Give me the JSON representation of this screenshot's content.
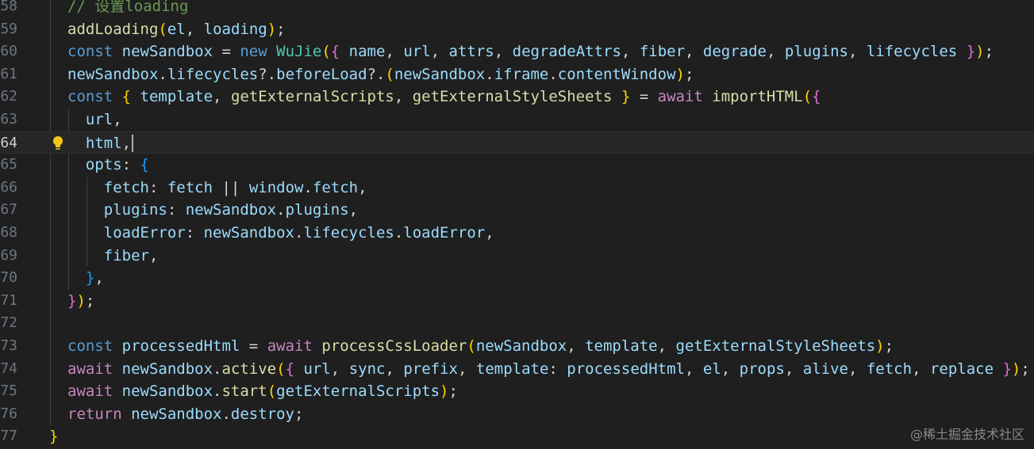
{
  "editor": {
    "active_line": "64",
    "lines": [
      {
        "num": "58",
        "tokens": [
          {
            "t": "// 设置loading",
            "c": "com"
          }
        ]
      },
      {
        "num": "59",
        "tokens": [
          {
            "t": "addLoading",
            "c": "fn"
          },
          {
            "t": "(",
            "c": "b1"
          },
          {
            "t": "el",
            "c": "var"
          },
          {
            "t": ", ",
            "c": "txt"
          },
          {
            "t": "loading",
            "c": "var"
          },
          {
            "t": ")",
            "c": "b1"
          },
          {
            "t": ";",
            "c": "txt"
          }
        ]
      },
      {
        "num": "60",
        "tokens": [
          {
            "t": "const ",
            "c": "kw"
          },
          {
            "t": "newSandbox",
            "c": "var"
          },
          {
            "t": " = ",
            "c": "txt"
          },
          {
            "t": "new ",
            "c": "kw"
          },
          {
            "t": "WuJie",
            "c": "cls"
          },
          {
            "t": "(",
            "c": "b1"
          },
          {
            "t": "{",
            "c": "b2"
          },
          {
            "t": " name",
            "c": "var"
          },
          {
            "t": ", ",
            "c": "txt"
          },
          {
            "t": "url",
            "c": "var"
          },
          {
            "t": ", ",
            "c": "txt"
          },
          {
            "t": "attrs",
            "c": "var"
          },
          {
            "t": ", ",
            "c": "txt"
          },
          {
            "t": "degradeAttrs",
            "c": "var"
          },
          {
            "t": ", ",
            "c": "txt"
          },
          {
            "t": "fiber",
            "c": "var"
          },
          {
            "t": ", ",
            "c": "txt"
          },
          {
            "t": "degrade",
            "c": "var"
          },
          {
            "t": ", ",
            "c": "txt"
          },
          {
            "t": "plugins",
            "c": "var"
          },
          {
            "t": ", ",
            "c": "txt"
          },
          {
            "t": "lifecycles ",
            "c": "var"
          },
          {
            "t": "}",
            "c": "b2"
          },
          {
            "t": ")",
            "c": "b1"
          },
          {
            "t": ";",
            "c": "txt"
          }
        ]
      },
      {
        "num": "61",
        "tokens": [
          {
            "t": "newSandbox",
            "c": "var"
          },
          {
            "t": ".",
            "c": "txt"
          },
          {
            "t": "lifecycles",
            "c": "var"
          },
          {
            "t": "?.",
            "c": "txt"
          },
          {
            "t": "beforeLoad",
            "c": "var"
          },
          {
            "t": "?.",
            "c": "txt"
          },
          {
            "t": "(",
            "c": "b1"
          },
          {
            "t": "newSandbox",
            "c": "var"
          },
          {
            "t": ".",
            "c": "txt"
          },
          {
            "t": "iframe",
            "c": "var"
          },
          {
            "t": ".",
            "c": "txt"
          },
          {
            "t": "contentWindow",
            "c": "var"
          },
          {
            "t": ")",
            "c": "b1"
          },
          {
            "t": ";",
            "c": "txt"
          }
        ]
      },
      {
        "num": "62",
        "tokens": [
          {
            "t": "const ",
            "c": "kw"
          },
          {
            "t": "{",
            "c": "b1"
          },
          {
            "t": " template",
            "c": "var"
          },
          {
            "t": ", ",
            "c": "txt"
          },
          {
            "t": "getExternalScripts",
            "c": "fn"
          },
          {
            "t": ", ",
            "c": "txt"
          },
          {
            "t": "getExternalStyleSheets ",
            "c": "fn"
          },
          {
            "t": "}",
            "c": "b1"
          },
          {
            "t": " = ",
            "c": "txt"
          },
          {
            "t": "await ",
            "c": "ctl"
          },
          {
            "t": "importHTML",
            "c": "fn"
          },
          {
            "t": "(",
            "c": "b1"
          },
          {
            "t": "{",
            "c": "b2"
          }
        ]
      },
      {
        "num": "63",
        "tokens": [
          {
            "t": "  url",
            "c": "var"
          },
          {
            "t": ",",
            "c": "txt"
          }
        ]
      },
      {
        "num": "64",
        "tokens": [
          {
            "t": "  html",
            "c": "var"
          },
          {
            "t": ",",
            "c": "txt"
          }
        ],
        "cursor": true,
        "bulb": true
      },
      {
        "num": "65",
        "tokens": [
          {
            "t": "  opts",
            "c": "var"
          },
          {
            "t": ": ",
            "c": "txt"
          },
          {
            "t": "{",
            "c": "b3"
          }
        ]
      },
      {
        "num": "66",
        "tokens": [
          {
            "t": "    fetch",
            "c": "var"
          },
          {
            "t": ": ",
            "c": "txt"
          },
          {
            "t": "fetch",
            "c": "var"
          },
          {
            "t": " || ",
            "c": "txt"
          },
          {
            "t": "window",
            "c": "var"
          },
          {
            "t": ".",
            "c": "txt"
          },
          {
            "t": "fetch",
            "c": "var"
          },
          {
            "t": ",",
            "c": "txt"
          }
        ]
      },
      {
        "num": "67",
        "tokens": [
          {
            "t": "    plugins",
            "c": "var"
          },
          {
            "t": ": ",
            "c": "txt"
          },
          {
            "t": "newSandbox",
            "c": "var"
          },
          {
            "t": ".",
            "c": "txt"
          },
          {
            "t": "plugins",
            "c": "var"
          },
          {
            "t": ",",
            "c": "txt"
          }
        ]
      },
      {
        "num": "68",
        "tokens": [
          {
            "t": "    loadError",
            "c": "var"
          },
          {
            "t": ": ",
            "c": "txt"
          },
          {
            "t": "newSandbox",
            "c": "var"
          },
          {
            "t": ".",
            "c": "txt"
          },
          {
            "t": "lifecycles",
            "c": "var"
          },
          {
            "t": ".",
            "c": "txt"
          },
          {
            "t": "loadError",
            "c": "var"
          },
          {
            "t": ",",
            "c": "txt"
          }
        ]
      },
      {
        "num": "69",
        "tokens": [
          {
            "t": "    fiber",
            "c": "var"
          },
          {
            "t": ",",
            "c": "txt"
          }
        ]
      },
      {
        "num": "70",
        "tokens": [
          {
            "t": "  }",
            "c": "b3"
          },
          {
            "t": ",",
            "c": "txt"
          }
        ]
      },
      {
        "num": "71",
        "tokens": [
          {
            "t": "}",
            "c": "b2"
          },
          {
            "t": ")",
            "c": "b1"
          },
          {
            "t": ";",
            "c": "txt"
          }
        ]
      },
      {
        "num": "72",
        "tokens": []
      },
      {
        "num": "73",
        "tokens": [
          {
            "t": "const ",
            "c": "kw"
          },
          {
            "t": "processedHtml",
            "c": "var"
          },
          {
            "t": " = ",
            "c": "txt"
          },
          {
            "t": "await ",
            "c": "ctl"
          },
          {
            "t": "processCssLoader",
            "c": "fn"
          },
          {
            "t": "(",
            "c": "b1"
          },
          {
            "t": "newSandbox",
            "c": "var"
          },
          {
            "t": ", ",
            "c": "txt"
          },
          {
            "t": "template",
            "c": "var"
          },
          {
            "t": ", ",
            "c": "txt"
          },
          {
            "t": "getExternalStyleSheets",
            "c": "var"
          },
          {
            "t": ")",
            "c": "b1"
          },
          {
            "t": ";",
            "c": "txt"
          }
        ]
      },
      {
        "num": "74",
        "tokens": [
          {
            "t": "await ",
            "c": "ctl"
          },
          {
            "t": "newSandbox",
            "c": "var"
          },
          {
            "t": ".",
            "c": "txt"
          },
          {
            "t": "active",
            "c": "fn"
          },
          {
            "t": "(",
            "c": "b1"
          },
          {
            "t": "{",
            "c": "b2"
          },
          {
            "t": " url",
            "c": "var"
          },
          {
            "t": ", ",
            "c": "txt"
          },
          {
            "t": "sync",
            "c": "var"
          },
          {
            "t": ", ",
            "c": "txt"
          },
          {
            "t": "prefix",
            "c": "var"
          },
          {
            "t": ", ",
            "c": "txt"
          },
          {
            "t": "template",
            "c": "var"
          },
          {
            "t": ": ",
            "c": "txt"
          },
          {
            "t": "processedHtml",
            "c": "var"
          },
          {
            "t": ", ",
            "c": "txt"
          },
          {
            "t": "el",
            "c": "var"
          },
          {
            "t": ", ",
            "c": "txt"
          },
          {
            "t": "props",
            "c": "var"
          },
          {
            "t": ", ",
            "c": "txt"
          },
          {
            "t": "alive",
            "c": "var"
          },
          {
            "t": ", ",
            "c": "txt"
          },
          {
            "t": "fetch",
            "c": "var"
          },
          {
            "t": ", ",
            "c": "txt"
          },
          {
            "t": "replace ",
            "c": "var"
          },
          {
            "t": "}",
            "c": "b2"
          },
          {
            "t": ")",
            "c": "b1"
          },
          {
            "t": ";",
            "c": "txt"
          }
        ]
      },
      {
        "num": "75",
        "tokens": [
          {
            "t": "await ",
            "c": "ctl"
          },
          {
            "t": "newSandbox",
            "c": "var"
          },
          {
            "t": ".",
            "c": "txt"
          },
          {
            "t": "start",
            "c": "fn"
          },
          {
            "t": "(",
            "c": "b1"
          },
          {
            "t": "getExternalScripts",
            "c": "var"
          },
          {
            "t": ")",
            "c": "b1"
          },
          {
            "t": ";",
            "c": "txt"
          }
        ]
      },
      {
        "num": "76",
        "tokens": [
          {
            "t": "return ",
            "c": "ctl"
          },
          {
            "t": "newSandbox",
            "c": "var"
          },
          {
            "t": ".",
            "c": "txt"
          },
          {
            "t": "destroy",
            "c": "var"
          },
          {
            "t": ";",
            "c": "txt"
          }
        ]
      },
      {
        "num": "77",
        "tokens": [
          {
            "t": "}",
            "c": "b1"
          }
        ],
        "outdent": true
      }
    ]
  },
  "icons": {
    "lightbulb": "lightbulb-icon"
  },
  "watermark": "@稀土掘金技术社区"
}
